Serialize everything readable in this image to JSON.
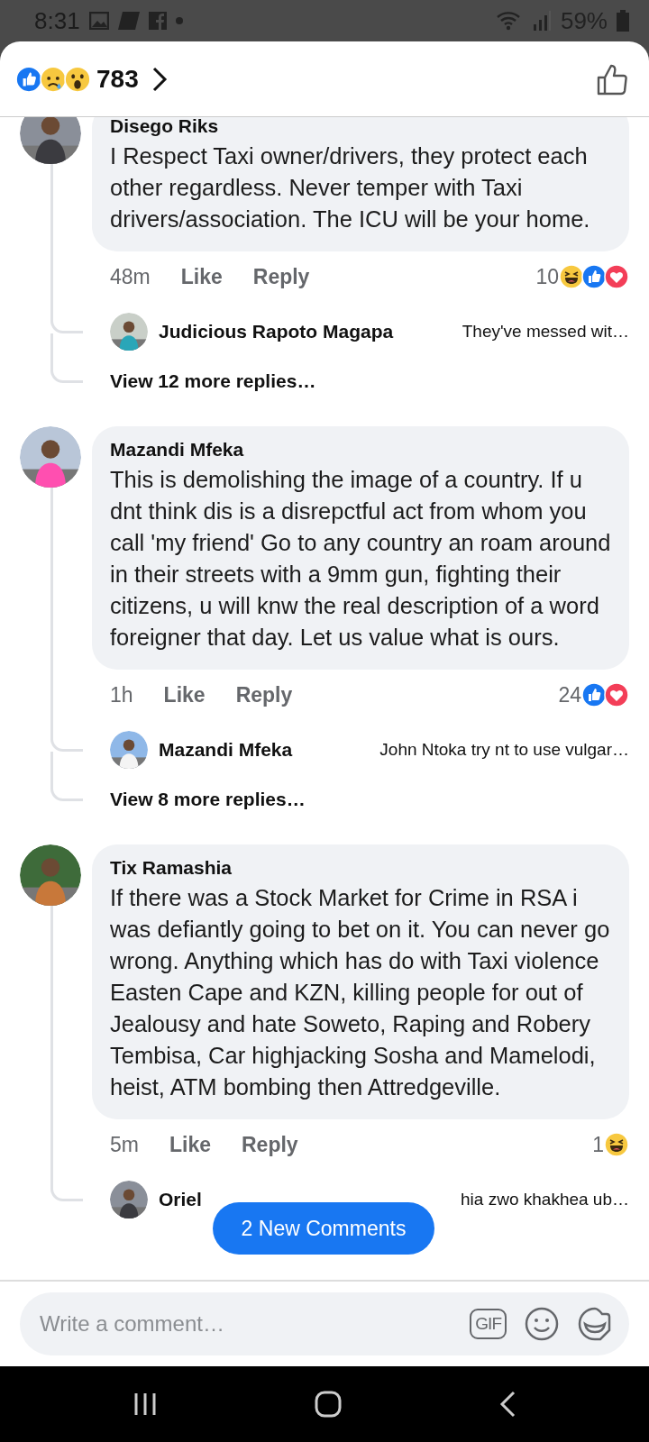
{
  "status_bar": {
    "time": "8:31",
    "battery": "59%"
  },
  "header": {
    "reactions": [
      {
        "kind": "like"
      },
      {
        "kind": "sad"
      },
      {
        "kind": "wow"
      }
    ],
    "count": "783"
  },
  "comments": [
    {
      "author": "Disego Riks",
      "avatar": {
        "kind": "picture"
      },
      "text": "I Respect Taxi owner/drivers, they protect each other regardless.  Never temper with Taxi drivers/association. The ICU will be your home.",
      "time": "48m",
      "like": "Like",
      "reply": "Reply",
      "reaction_count": "10",
      "reactions": [
        {
          "kind": "haha"
        },
        {
          "kind": "like"
        },
        {
          "kind": "love"
        }
      ],
      "replies": [
        {
          "author": "Judicious Rapoto Magapa",
          "avatar": {
            "kind": "picture"
          },
          "text": "They've messed wit…"
        }
      ],
      "view_more": "View 12 more replies…"
    },
    {
      "author": "Mazandi Mfeka",
      "avatar": {
        "kind": "picture"
      },
      "text": "This is demolishing the image of a country. If u dnt think dis is a disrepctful act from whom you call  'my friend' Go to any country an roam around in their streets with a 9mm gun, fighting their citizens, u will knw the real description of a word foreigner that day. Let us value what is ours.",
      "time": "1h",
      "like": "Like",
      "reply": "Reply",
      "reaction_count": "24",
      "reactions": [
        {
          "kind": "like"
        },
        {
          "kind": "love"
        }
      ],
      "replies": [
        {
          "author": "Mazandi Mfeka",
          "avatar": {
            "kind": "picture"
          },
          "text": "John Ntoka try nt to use vulgar…"
        }
      ],
      "view_more": "View 8 more replies…"
    },
    {
      "author": "Tix Ramashia",
      "avatar": {
        "kind": "picture"
      },
      "text": "If there was a Stock Market for Crime in RSA i was defiantly going to bet on it. You can never go wrong. Anything which has do with Taxi violence Easten Cape and KZN, killing people for out of Jealousy and hate Soweto, Raping and Robery Tembisa, Car highjacking Sosha and Mamelodi, heist, ATM bombing then Attredgeville.",
      "time": "5m",
      "like": "Like",
      "reply": "Reply",
      "reaction_count": "1",
      "reactions": [
        {
          "kind": "haha"
        }
      ],
      "replies": [
        {
          "author": "Oriel",
          "avatar": {
            "kind": "picture"
          },
          "text": "hia zwo khakhea ub…"
        }
      ]
    }
  ],
  "new_comments_pill": "2 New Comments",
  "composer": {
    "placeholder": "Write a comment…",
    "gif": "GIF"
  }
}
